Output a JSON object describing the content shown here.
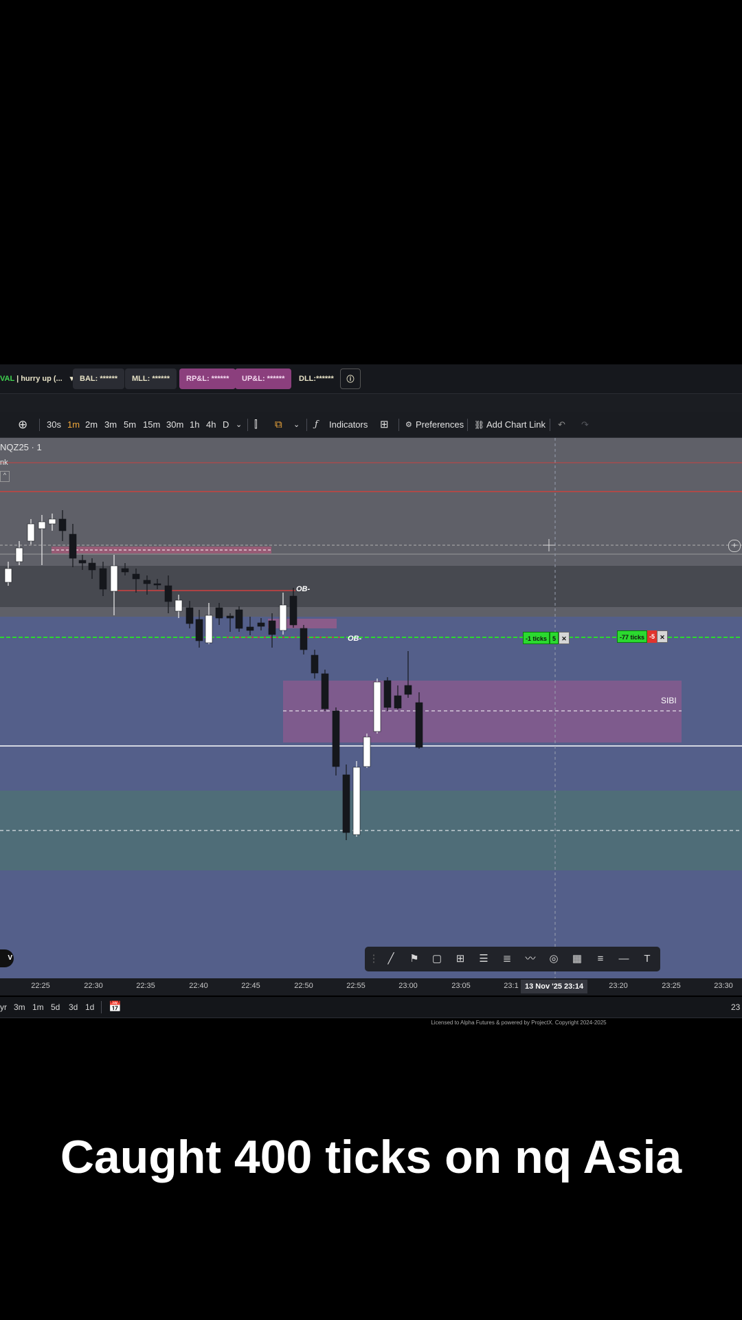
{
  "account_bar": {
    "account_prefix": "VAL",
    "account_name": "| hurry up (...",
    "balance": "BAL: ******",
    "mll": "MLL: ******",
    "rpl": "RP&L: ******",
    "upl": "UP&L: ******",
    "dll": "DLL:******",
    "info_icon": "info-icon"
  },
  "toolbar": {
    "add_icon": "plus-circle-icon",
    "timeframes": [
      "30s",
      "1m",
      "2m",
      "3m",
      "5m",
      "15m",
      "30m",
      "1h",
      "4h",
      "D"
    ],
    "active_timeframe": "1m",
    "indicators_label": "Indicators",
    "preferences_label": "Preferences",
    "chart_link_label": "Add Chart Link",
    "accent_color": "#f0a73a"
  },
  "chart": {
    "symbol": "NQZ25 · 1",
    "symbol_sub": "nk",
    "labels": {
      "ob1": "OB-",
      "ob2": "OB-",
      "sibi": "SIBI"
    },
    "orders": [
      {
        "ticks": "-1 ticks",
        "qty": "5"
      },
      {
        "ticks": "-77 ticks",
        "qty": "-5"
      }
    ],
    "colors": {
      "bull": "#ffffff",
      "bear": "#15171c",
      "entry_line": "#2bd92f"
    }
  },
  "time_axis": {
    "ticks": [
      "22:25",
      "22:30",
      "22:35",
      "22:40",
      "22:45",
      "22:50",
      "22:55",
      "23:00",
      "23:05",
      "23:1",
      "23:20",
      "23:25",
      "23:30"
    ],
    "cursor_label": "13 Nov '25   23:14"
  },
  "range_bar": {
    "ranges": [
      "yr",
      "3m",
      "1m",
      "5d",
      "3d",
      "1d"
    ],
    "right_label": "23"
  },
  "license": "Licensed to Alpha Futures & powered by ProjectX. Copyright 2024-2025",
  "caption": "Caught 400 ticks on nq Asia"
}
